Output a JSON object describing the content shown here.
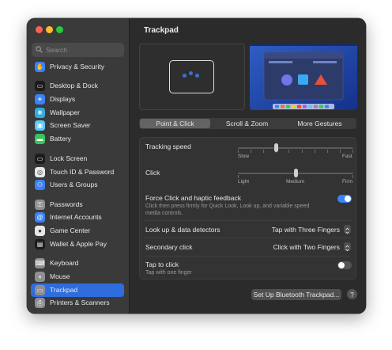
{
  "window": {
    "title": "Trackpad"
  },
  "search": {
    "placeholder": "Search"
  },
  "sidebar": {
    "items": [
      {
        "label": "Privacy & Security",
        "icon": "hand-icon",
        "icon_color": "#3a82f7",
        "glyph": "✋"
      },
      {
        "label": "Desktop & Dock",
        "icon": "dock-icon",
        "icon_color": "#1c1c1e",
        "glyph": "▭"
      },
      {
        "label": "Displays",
        "icon": "sun-icon",
        "icon_color": "#3a82f7",
        "glyph": "☀"
      },
      {
        "label": "Wallpaper",
        "icon": "wallpaper-icon",
        "icon_color": "#35aadc",
        "glyph": "❋"
      },
      {
        "label": "Screen Saver",
        "icon": "screen-saver-icon",
        "icon_color": "#5ac8fa",
        "glyph": "▣"
      },
      {
        "label": "Battery",
        "icon": "battery-icon",
        "icon_color": "#34c759",
        "glyph": "▬"
      },
      {
        "label": "Lock Screen",
        "icon": "lock-screen-icon",
        "icon_color": "#1c1c1e",
        "glyph": "▭"
      },
      {
        "label": "Touch ID & Password",
        "icon": "fingerprint-icon",
        "icon_color": "#e8e8e8",
        "glyph": "◎"
      },
      {
        "label": "Users & Groups",
        "icon": "users-icon",
        "icon_color": "#3a82f7",
        "glyph": "⚇"
      },
      {
        "label": "Passwords",
        "icon": "key-icon",
        "icon_color": "#8e8e93",
        "glyph": "⚿"
      },
      {
        "label": "Internet Accounts",
        "icon": "at-icon",
        "icon_color": "#3a82f7",
        "glyph": "@"
      },
      {
        "label": "Game Center",
        "icon": "game-center-icon",
        "icon_color": "#e8e8e8",
        "glyph": "●"
      },
      {
        "label": "Wallet & Apple Pay",
        "icon": "wallet-icon",
        "icon_color": "#1c1c1e",
        "glyph": "▤"
      },
      {
        "label": "Keyboard",
        "icon": "keyboard-icon",
        "icon_color": "#8e8e93",
        "glyph": "⌨"
      },
      {
        "label": "Mouse",
        "icon": "mouse-icon",
        "icon_color": "#8e8e93",
        "glyph": "◖"
      },
      {
        "label": "Trackpad",
        "icon": "trackpad-icon",
        "icon_color": "#8e8e93",
        "glyph": "▭",
        "active": true
      },
      {
        "label": "Printers & Scanners",
        "icon": "printer-icon",
        "icon_color": "#8e8e93",
        "glyph": "⎙"
      }
    ]
  },
  "tabs": [
    {
      "label": "Point & Click",
      "active": true
    },
    {
      "label": "Scroll & Zoom",
      "active": false
    },
    {
      "label": "More Gestures",
      "active": false
    }
  ],
  "settings": {
    "tracking_speed": {
      "label": "Tracking speed",
      "min_label": "Slow",
      "max_label": "Fast",
      "value_fraction": 0.33
    },
    "click": {
      "label": "Click",
      "options": [
        "Light",
        "Medium",
        "Firm"
      ],
      "value": "Medium"
    },
    "force_click": {
      "label": "Force Click and haptic feedback",
      "description": "Click then press firmly for Quick Look, Look up, and variable speed media controls.",
      "enabled": true
    },
    "look_up": {
      "label": "Look up & data detectors",
      "value": "Tap with Three Fingers"
    },
    "secondary_click": {
      "label": "Secondary click",
      "value": "Click with Two Fingers"
    },
    "tap_to_click": {
      "label": "Tap to click",
      "description": "Tap with one finger",
      "enabled": false
    }
  },
  "footer": {
    "setup_button": "Set Up Bluetooth Trackpad...",
    "help": "?"
  },
  "colors": {
    "accent": "#2f6dde",
    "toggle_on": "#3b82f6",
    "window_bg": "#2b2b2b",
    "sidebar_bg": "#3a3a3a"
  }
}
